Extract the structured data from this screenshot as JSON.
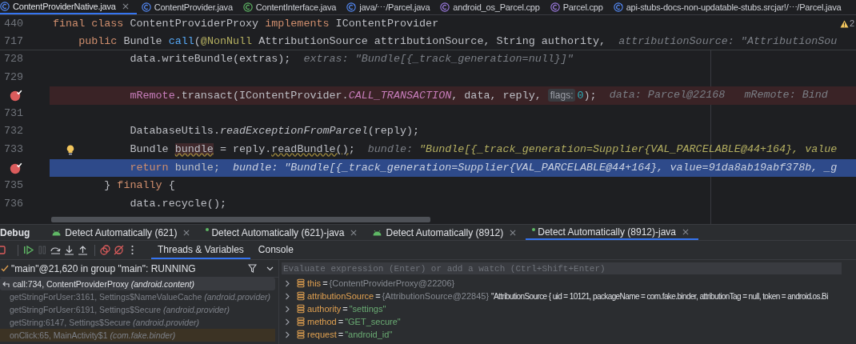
{
  "file_tabs": [
    {
      "label": "ContentProviderNative.java",
      "kind": "class",
      "selected": true
    },
    {
      "label": "ContentProvider.java",
      "kind": "class",
      "selected": false
    },
    {
      "label": "ContentInterface.java",
      "kind": "interface",
      "selected": false
    },
    {
      "label": "java/⋯/Parcel.java",
      "kind": "library",
      "selected": false
    },
    {
      "label": "android_os_Parcel.cpp",
      "kind": "cpp",
      "selected": false
    },
    {
      "label": "Parcel.cpp",
      "kind": "cpp",
      "selected": false
    },
    {
      "label": "api-stubs-docs-non-updatable-stubs.srcjar!/⋯/Parcel.java",
      "kind": "library",
      "selected": false
    }
  ],
  "editor": {
    "warning_count": "2",
    "sticky_lines": [
      {
        "number": "440",
        "code": [
          {
            "text": "final class ",
            "kind": "keyword"
          },
          {
            "text": "ContentProviderProxy ",
            "kind": "plain"
          },
          {
            "text": "implements ",
            "kind": "keyword"
          },
          {
            "text": "IContentProvider",
            "kind": "plain"
          }
        ]
      },
      {
        "number": "717",
        "code": [
          {
            "text": "    public ",
            "kind": "keyword"
          },
          {
            "text": "Bundle ",
            "kind": "plain"
          },
          {
            "text": "call",
            "kind": "declaration"
          },
          {
            "text": "(",
            "kind": "plain"
          },
          {
            "text": "@NonNull ",
            "kind": "annotation"
          },
          {
            "text": "AttributionSource attributionSource, String authority,",
            "kind": "plain"
          }
        ],
        "hint": [
          {
            "text": "attributionSource: \"AttributionSou",
            "kind": "hint"
          }
        ]
      }
    ],
    "lines": [
      {
        "number": "728",
        "kind": "normal",
        "breakpoint": false,
        "bulb": false,
        "code": [
          {
            "text": "            data.writeBundle(extras);",
            "kind": "plain"
          }
        ],
        "hint": [
          {
            "text": "extras: \"Bundle[{_track_generation=null}]\"",
            "kind": "hint"
          }
        ]
      },
      {
        "number": "729",
        "kind": "normal",
        "breakpoint": false,
        "bulb": false
      },
      {
        "kind": "breakpoint",
        "breakpoint": true,
        "bulb": false,
        "code": [
          {
            "text": "            mRemote",
            "kind": "field"
          },
          {
            "text": ".transact(IContentProvider.",
            "kind": "plain"
          },
          {
            "text": "CALL_TRANSACTION",
            "kind": "static"
          },
          {
            "text": ", data, reply, ",
            "kind": "plain"
          },
          {
            "text": "flags:",
            "kind": "inlay"
          },
          {
            "text": "0",
            "kind": "number"
          },
          {
            "text": ");",
            "kind": "plain"
          }
        ],
        "hint": [
          {
            "text": "data: Parcel@22168   mRemote: Bind",
            "kind": "hint"
          }
        ]
      },
      {
        "number": "731",
        "kind": "normal",
        "breakpoint": false,
        "bulb": false
      },
      {
        "number": "732",
        "kind": "normal",
        "breakpoint": false,
        "bulb": false,
        "code": [
          {
            "text": "            DatabaseUtils.",
            "kind": "plain"
          },
          {
            "text": "readExceptionFromParcel",
            "kind": "italic"
          },
          {
            "text": "(reply);",
            "kind": "plain"
          }
        ]
      },
      {
        "number": "733",
        "kind": "normal",
        "breakpoint": false,
        "bulb": true,
        "code": [
          {
            "text": "            Bundle ",
            "kind": "plain"
          },
          {
            "text": "bundle",
            "kind": "reference"
          },
          {
            "text": " = reply.",
            "kind": "plain"
          },
          {
            "text": "readBundle()",
            "kind": "warning"
          },
          {
            "text": ";",
            "kind": "plain"
          }
        ],
        "hint": [
          {
            "text": "bundle: ",
            "kind": "hint"
          },
          {
            "text": "\"Bundle[{_track_generation=Supplier{VAL_PARCELABLE@44+164}, value",
            "kind": "string"
          }
        ]
      },
      {
        "kind": "execution",
        "breakpoint": true,
        "bulb": false,
        "code": [
          {
            "text": "            return ",
            "kind": "keyword"
          },
          {
            "text": "bundle;",
            "kind": "plain"
          }
        ],
        "hint": [
          {
            "text": "bundle: \"Bundle[{_track_generation=Supplier{VAL_PARCELABLE@44+164}, value=91da8ab19abf378b, _g",
            "kind": "hint"
          }
        ]
      },
      {
        "number": "735",
        "kind": "normal",
        "breakpoint": false,
        "bulb": false,
        "code": [
          {
            "text": "        } ",
            "kind": "plain"
          },
          {
            "text": "finally ",
            "kind": "keyword"
          },
          {
            "text": "{",
            "kind": "plain"
          }
        ]
      },
      {
        "number": "736",
        "kind": "normal",
        "breakpoint": false,
        "bulb": false,
        "code": [
          {
            "text": "            data.recycle();",
            "kind": "plain"
          }
        ]
      }
    ]
  },
  "debug": {
    "title": "Debug",
    "sessions": [
      {
        "label": "Detect Automatically (621)",
        "kind": "android",
        "selected": false
      },
      {
        "label": "Detect Automatically (621)-java",
        "kind": "java",
        "selected": false
      },
      {
        "label": "Detect Automatically (8912)",
        "kind": "android",
        "selected": false
      },
      {
        "label": "Detect Automatically (8912)-java",
        "kind": "java",
        "selected": true
      }
    ],
    "toolbar": [
      {
        "kind": "stop",
        "disabled": false
      },
      {
        "kind": "resume",
        "disabled": false
      },
      {
        "kind": "pause",
        "disabled": true
      },
      {
        "kind": "step-over",
        "disabled": false
      },
      {
        "kind": "step-into",
        "disabled": false
      },
      {
        "kind": "step-out",
        "disabled": false
      },
      {
        "kind": "breakpoints",
        "disabled": false
      },
      {
        "kind": "mute",
        "disabled": false
      },
      {
        "kind": "more",
        "disabled": false
      }
    ],
    "tabs": [
      {
        "label": "Threads & Variables",
        "selected": true
      },
      {
        "label": "Console",
        "selected": false
      }
    ],
    "thread": {
      "label": "\"main\"@21,620 in group \"main\": RUNNING"
    },
    "frames": [
      {
        "text": "call:734, ContentProviderProxy *(android.content)*",
        "selected": true,
        "highlighted": false
      },
      {
        "text": "getStringForUser:3161, Settings$NameValueCache *(android.provider)*",
        "selected": false,
        "highlighted": false
      },
      {
        "text": "getStringForUser:6191, Settings$Secure *(android.provider)*",
        "selected": false,
        "highlighted": false
      },
      {
        "text": "getString:6147, Settings$Secure *(android.provider)*",
        "selected": false,
        "highlighted": false
      },
      {
        "text": "onClick:65, MainActivity$1 *(com.fake.binder)*",
        "selected": false,
        "highlighted": true
      }
    ],
    "evaluate": {
      "placeholder": "Evaluate expression (Enter) or add a watch (Ctrl+Shift+Enter)"
    },
    "variables": [
      {
        "name": "this",
        "operator": "=",
        "ref": "{ContentProviderProxy@22206}"
      },
      {
        "name": "attributionSource",
        "operator": "=",
        "ref": "{AttributionSource@22845}",
        "value": "\"AttributionSource { uid = 10121, packageName = com.fake.binder, attributionTag = null, token = android.os.Bi",
        "kind": "text"
      },
      {
        "name": "authority",
        "operator": "=",
        "value": "\"settings\"",
        "kind": "string"
      },
      {
        "name": "method",
        "operator": "=",
        "value": "\"GET_secure\"",
        "kind": "string"
      },
      {
        "name": "request",
        "operator": "=",
        "value": "\"android_id\"",
        "kind": "string"
      }
    ]
  }
}
